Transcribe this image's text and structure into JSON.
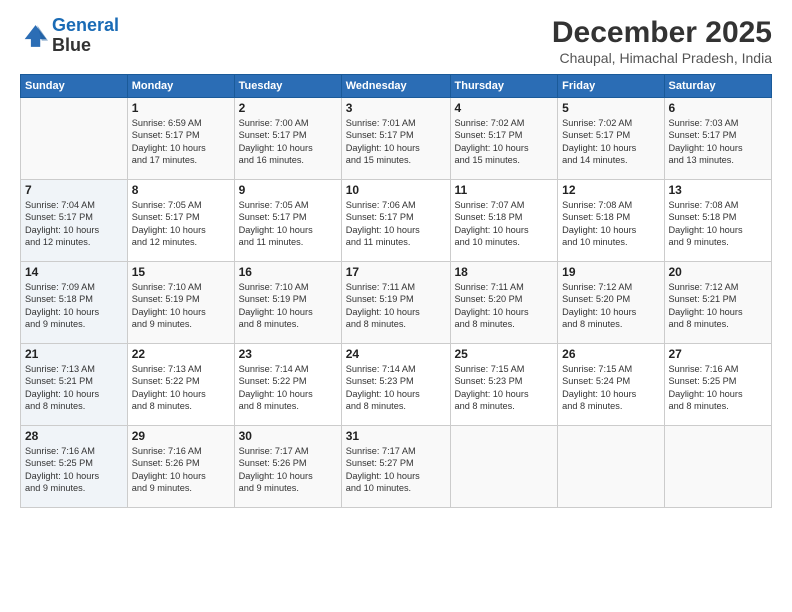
{
  "header": {
    "logo_line1": "General",
    "logo_line2": "Blue",
    "month": "December 2025",
    "location": "Chaupal, Himachal Pradesh, India"
  },
  "days_of_week": [
    "Sunday",
    "Monday",
    "Tuesday",
    "Wednesday",
    "Thursday",
    "Friday",
    "Saturday"
  ],
  "weeks": [
    [
      {
        "day": "",
        "info": ""
      },
      {
        "day": "1",
        "info": "Sunrise: 6:59 AM\nSunset: 5:17 PM\nDaylight: 10 hours\nand 17 minutes."
      },
      {
        "day": "2",
        "info": "Sunrise: 7:00 AM\nSunset: 5:17 PM\nDaylight: 10 hours\nand 16 minutes."
      },
      {
        "day": "3",
        "info": "Sunrise: 7:01 AM\nSunset: 5:17 PM\nDaylight: 10 hours\nand 15 minutes."
      },
      {
        "day": "4",
        "info": "Sunrise: 7:02 AM\nSunset: 5:17 PM\nDaylight: 10 hours\nand 15 minutes."
      },
      {
        "day": "5",
        "info": "Sunrise: 7:02 AM\nSunset: 5:17 PM\nDaylight: 10 hours\nand 14 minutes."
      },
      {
        "day": "6",
        "info": "Sunrise: 7:03 AM\nSunset: 5:17 PM\nDaylight: 10 hours\nand 13 minutes."
      }
    ],
    [
      {
        "day": "7",
        "info": "Sunrise: 7:04 AM\nSunset: 5:17 PM\nDaylight: 10 hours\nand 12 minutes."
      },
      {
        "day": "8",
        "info": "Sunrise: 7:05 AM\nSunset: 5:17 PM\nDaylight: 10 hours\nand 12 minutes."
      },
      {
        "day": "9",
        "info": "Sunrise: 7:05 AM\nSunset: 5:17 PM\nDaylight: 10 hours\nand 11 minutes."
      },
      {
        "day": "10",
        "info": "Sunrise: 7:06 AM\nSunset: 5:17 PM\nDaylight: 10 hours\nand 11 minutes."
      },
      {
        "day": "11",
        "info": "Sunrise: 7:07 AM\nSunset: 5:18 PM\nDaylight: 10 hours\nand 10 minutes."
      },
      {
        "day": "12",
        "info": "Sunrise: 7:08 AM\nSunset: 5:18 PM\nDaylight: 10 hours\nand 10 minutes."
      },
      {
        "day": "13",
        "info": "Sunrise: 7:08 AM\nSunset: 5:18 PM\nDaylight: 10 hours\nand 9 minutes."
      }
    ],
    [
      {
        "day": "14",
        "info": "Sunrise: 7:09 AM\nSunset: 5:18 PM\nDaylight: 10 hours\nand 9 minutes."
      },
      {
        "day": "15",
        "info": "Sunrise: 7:10 AM\nSunset: 5:19 PM\nDaylight: 10 hours\nand 9 minutes."
      },
      {
        "day": "16",
        "info": "Sunrise: 7:10 AM\nSunset: 5:19 PM\nDaylight: 10 hours\nand 8 minutes."
      },
      {
        "day": "17",
        "info": "Sunrise: 7:11 AM\nSunset: 5:19 PM\nDaylight: 10 hours\nand 8 minutes."
      },
      {
        "day": "18",
        "info": "Sunrise: 7:11 AM\nSunset: 5:20 PM\nDaylight: 10 hours\nand 8 minutes."
      },
      {
        "day": "19",
        "info": "Sunrise: 7:12 AM\nSunset: 5:20 PM\nDaylight: 10 hours\nand 8 minutes."
      },
      {
        "day": "20",
        "info": "Sunrise: 7:12 AM\nSunset: 5:21 PM\nDaylight: 10 hours\nand 8 minutes."
      }
    ],
    [
      {
        "day": "21",
        "info": "Sunrise: 7:13 AM\nSunset: 5:21 PM\nDaylight: 10 hours\nand 8 minutes."
      },
      {
        "day": "22",
        "info": "Sunrise: 7:13 AM\nSunset: 5:22 PM\nDaylight: 10 hours\nand 8 minutes."
      },
      {
        "day": "23",
        "info": "Sunrise: 7:14 AM\nSunset: 5:22 PM\nDaylight: 10 hours\nand 8 minutes."
      },
      {
        "day": "24",
        "info": "Sunrise: 7:14 AM\nSunset: 5:23 PM\nDaylight: 10 hours\nand 8 minutes."
      },
      {
        "day": "25",
        "info": "Sunrise: 7:15 AM\nSunset: 5:23 PM\nDaylight: 10 hours\nand 8 minutes."
      },
      {
        "day": "26",
        "info": "Sunrise: 7:15 AM\nSunset: 5:24 PM\nDaylight: 10 hours\nand 8 minutes."
      },
      {
        "day": "27",
        "info": "Sunrise: 7:16 AM\nSunset: 5:25 PM\nDaylight: 10 hours\nand 8 minutes."
      }
    ],
    [
      {
        "day": "28",
        "info": "Sunrise: 7:16 AM\nSunset: 5:25 PM\nDaylight: 10 hours\nand 9 minutes."
      },
      {
        "day": "29",
        "info": "Sunrise: 7:16 AM\nSunset: 5:26 PM\nDaylight: 10 hours\nand 9 minutes."
      },
      {
        "day": "30",
        "info": "Sunrise: 7:17 AM\nSunset: 5:26 PM\nDaylight: 10 hours\nand 9 minutes."
      },
      {
        "day": "31",
        "info": "Sunrise: 7:17 AM\nSunset: 5:27 PM\nDaylight: 10 hours\nand 10 minutes."
      },
      {
        "day": "",
        "info": ""
      },
      {
        "day": "",
        "info": ""
      },
      {
        "day": "",
        "info": ""
      }
    ]
  ]
}
